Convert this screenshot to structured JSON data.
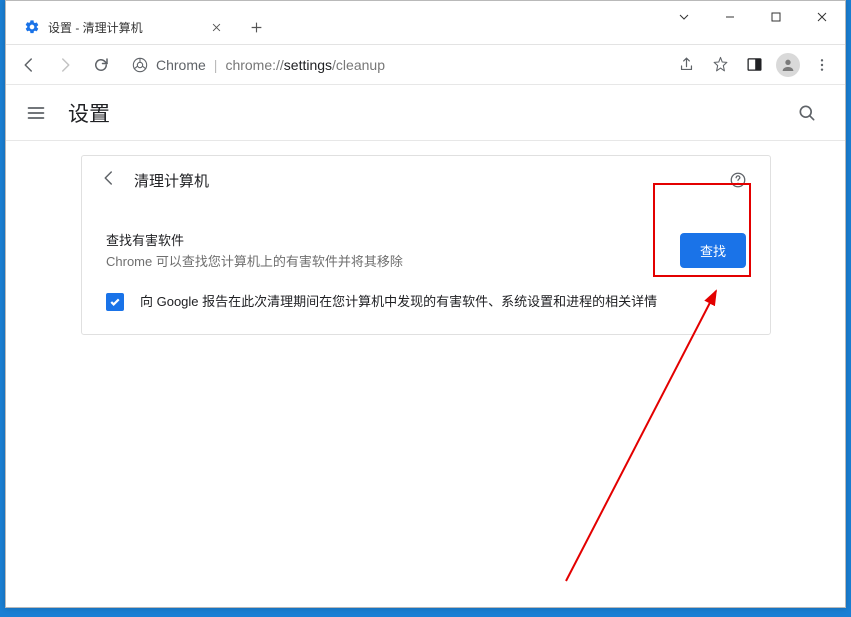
{
  "window": {
    "tab_title": "设置 - 清理计算机"
  },
  "address": {
    "origin_label": "Chrome",
    "url_prefix": "chrome://",
    "url_bold": "settings",
    "url_suffix": "/cleanup"
  },
  "settings": {
    "title": "设置"
  },
  "cleanup": {
    "page_title": "清理计算机",
    "find_harmful_title": "查找有害软件",
    "find_harmful_desc": "Chrome 可以查找您计算机上的有害软件并将其移除",
    "find_button": "查找",
    "report_checkbox_label": "向 Google 报告在此次清理期间在您计算机中发现的有害软件、系统设置和进程的相关详情",
    "report_checked": true
  }
}
